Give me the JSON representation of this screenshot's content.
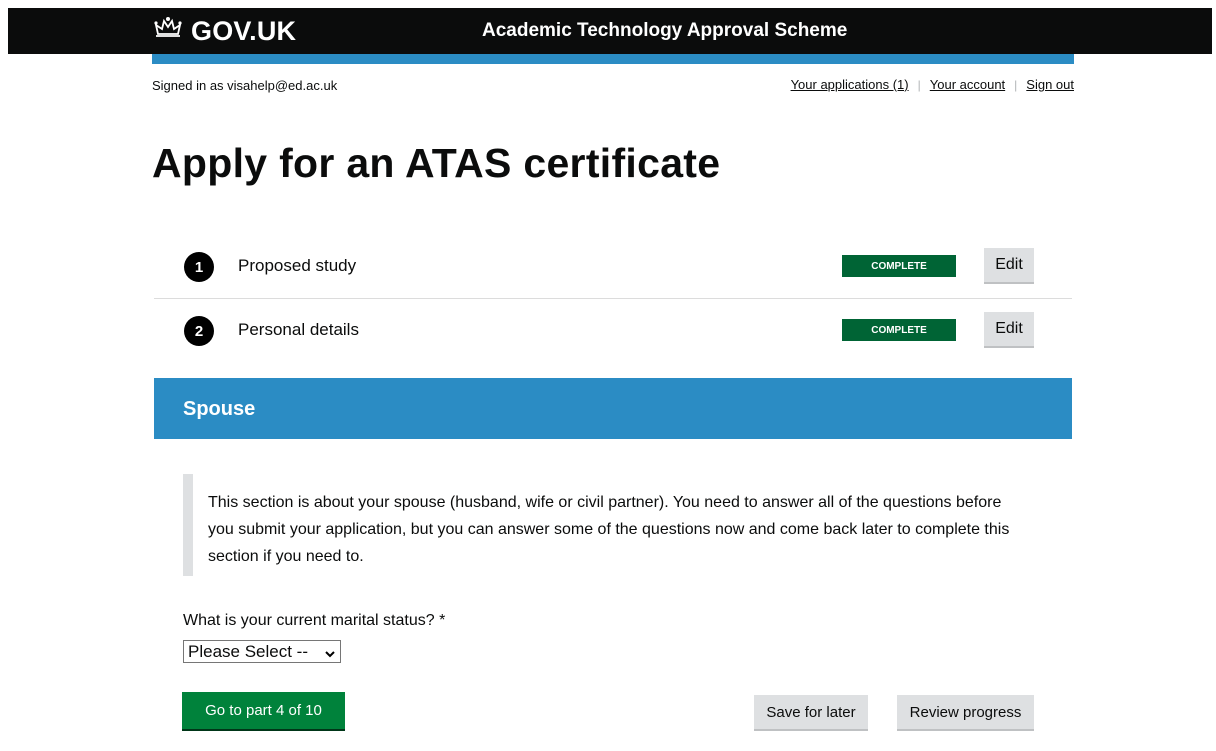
{
  "header": {
    "logo_text": "GOV.UK",
    "service_name": "Academic Technology Approval Scheme"
  },
  "account_bar": {
    "signed_in": "Signed in as visahelp@ed.ac.uk",
    "links": [
      "Your applications (1)",
      "Your account",
      "Sign out"
    ]
  },
  "page": {
    "title": "Apply for an ATAS certificate"
  },
  "tasks": [
    {
      "number": "1",
      "label": "Proposed study",
      "status": "COMPLETE",
      "action": "Edit"
    },
    {
      "number": "2",
      "label": "Personal details",
      "status": "COMPLETE",
      "action": "Edit"
    }
  ],
  "section": {
    "title": "Spouse",
    "intro": "This section is about your spouse (husband, wife or civil partner). You need to answer all of the questions before you submit your application, but you can answer some of the questions now and come back later to complete this section if you need to."
  },
  "form": {
    "question": "What is your current marital status? *",
    "select_value": "Please Select --"
  },
  "buttons": {
    "next": "Go to part 4 of 10",
    "save": "Save for later",
    "review": "Review progress"
  },
  "colors": {
    "header_bg": "#0b0c0c",
    "accent_blue": "#2b8cc4",
    "complete_green": "#006435",
    "button_green": "#00823b",
    "button_grey": "#dee0e2"
  }
}
